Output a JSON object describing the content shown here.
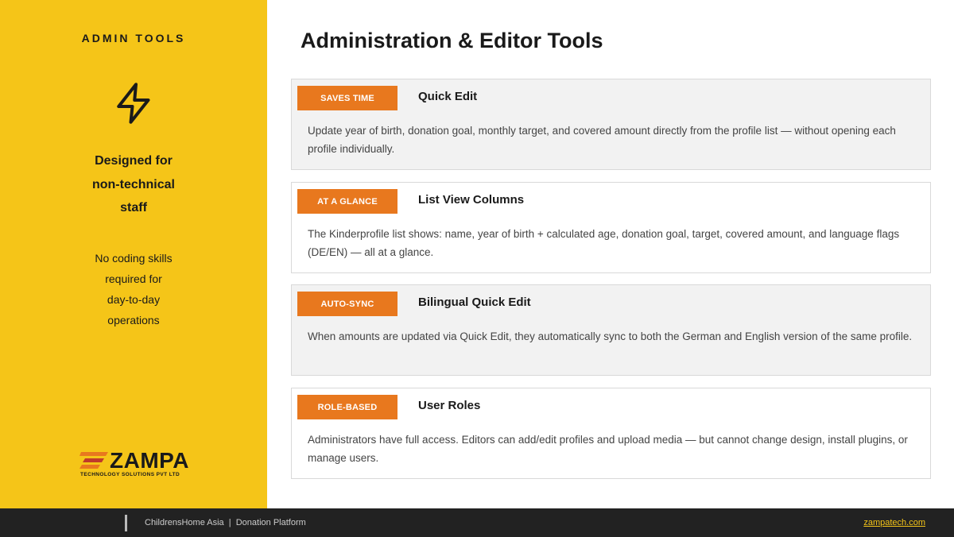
{
  "sidebar": {
    "title": "ADMIN TOOLS",
    "icon": "lightning-bolt-icon",
    "heading_lines": [
      "Designed for",
      "non-technical",
      "staff"
    ],
    "sub_lines": [
      "No coding skills",
      "required for",
      "day-to-day",
      "operations"
    ],
    "logo": {
      "name": "ZAMPA",
      "tagline": "TECHNOLOGY SOLUTIONS PVT LTD"
    }
  },
  "main": {
    "title": "Administration & Editor Tools",
    "cards": [
      {
        "badge": "SAVES TIME",
        "title": "Quick Edit",
        "description": "Update year of birth, donation goal, monthly target, and covered amount directly from the profile list — without opening each profile individually."
      },
      {
        "badge": "AT A GLANCE",
        "title": "List View Columns",
        "description": "The Kinderprofile list shows: name, year of birth + calculated age, donation goal, target, covered amount, and language flags (DE/EN) — all at a glance."
      },
      {
        "badge": "AUTO-SYNC",
        "title": "Bilingual Quick Edit",
        "description": "When amounts are updated via Quick Edit, they automatically sync to both the German and English version of the same profile."
      },
      {
        "badge": "ROLE-BASED",
        "title": "User Roles",
        "description": "Administrators have full access. Editors can add/edit profiles and upload media — but cannot change design, install plugins, or manage users."
      }
    ]
  },
  "footer": {
    "text": "ChildrensHome Asia  |  Donation Platform",
    "link": "zampatech.com"
  },
  "colors": {
    "sidebar_bg": "#f5c518",
    "badge_bg": "#e8781e",
    "footer_bg": "#222222"
  }
}
